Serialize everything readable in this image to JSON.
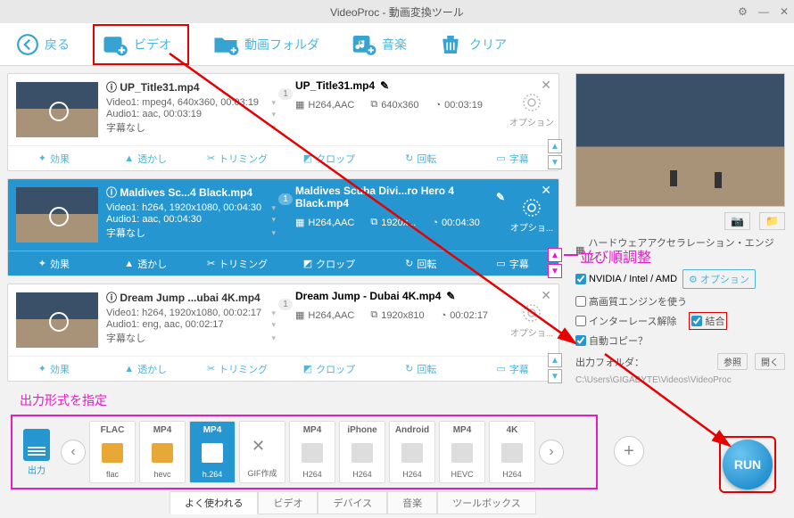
{
  "window": {
    "title": "VideoProc - 動画変換ツール"
  },
  "toolbar": {
    "back": "戻る",
    "video": "ビデオ",
    "folder": "動画フォルダ",
    "music": "音楽",
    "clear": "クリア"
  },
  "cards": [
    {
      "src_title": "UP_Title31.mp4",
      "video_line": "Video1: mpeg4, 640x360, 00:03:19",
      "audio_line": "Audio1: aac, 00:03:19",
      "sub_line": "字幕なし",
      "idx": "1",
      "out_title": "UP_Title31.mp4",
      "out_codec": "H264,AAC",
      "out_res": "640x360",
      "out_dur": "00:03:19",
      "opt": "オプション"
    },
    {
      "src_title": "Maldives Sc...4 Black.mp4",
      "video_line": "Video1: h264, 1920x1080, 00:04:30",
      "audio_line": "Audio1: aac, 00:04:30",
      "sub_line": "字幕なし",
      "idx": "1",
      "out_title": "Maldives Scuba Divi...ro Hero 4 Black.mp4",
      "out_codec": "H264,AAC",
      "out_res": "1920x...",
      "out_dur": "00:04:30",
      "opt": "オプショ..."
    },
    {
      "src_title": "Dream Jump ...ubai 4K.mp4",
      "video_line": "Video1: h264, 1920x1080, 00:02:17",
      "audio_line": "Audio1: eng, aac, 00:02:17",
      "sub_line": "字幕なし",
      "idx": "1",
      "out_title": "Dream Jump - Dubai 4K.mp4",
      "out_codec": "H264,AAC",
      "out_res": "1920x810",
      "out_dur": "00:02:17",
      "opt": "オプショ..."
    }
  ],
  "edit_btns": {
    "effect": "効果",
    "transparent": "透かし",
    "trim": "トリミング",
    "crop": "クロップ",
    "rotate": "回転",
    "subs": "字幕"
  },
  "right": {
    "hw_title": "ハードウェアアクセラレーション・エンジン：",
    "gpu_label": "NVIDIA / Intel / AMD",
    "options": "オプション",
    "hq_engine": "高画質エンジンを使う",
    "deinterlace": "インターレース解除",
    "merge": "結合",
    "autocopy": "自動コピー？",
    "out_folder_label": "出力フォルダ：",
    "browse": "参照",
    "open": "開く",
    "out_path": "C:\\Users\\GIGABYTE\\Videos\\VideoProc"
  },
  "formats": {
    "label": "出力形式を指定",
    "start": "出力",
    "items": [
      {
        "top": "FLAC",
        "bot": "flac"
      },
      {
        "top": "MP4",
        "bot": "hevc"
      },
      {
        "top": "MP4",
        "bot": "h.264"
      },
      {
        "top": "",
        "bot": "GIF作成"
      },
      {
        "top": "MP4",
        "bot": "H264"
      },
      {
        "top": "iPhone",
        "bot": "H264"
      },
      {
        "top": "Android",
        "bot": "H264"
      },
      {
        "top": "MP4",
        "bot": "HEVC"
      },
      {
        "top": "4K",
        "bot": "H264"
      }
    ]
  },
  "btabs": {
    "popular": "よく使われる",
    "video": "ビデオ",
    "device": "デバイス",
    "music": "音楽",
    "toolbox": "ツールボックス"
  },
  "run": "RUN",
  "anno": {
    "sort": "並び順調整"
  }
}
